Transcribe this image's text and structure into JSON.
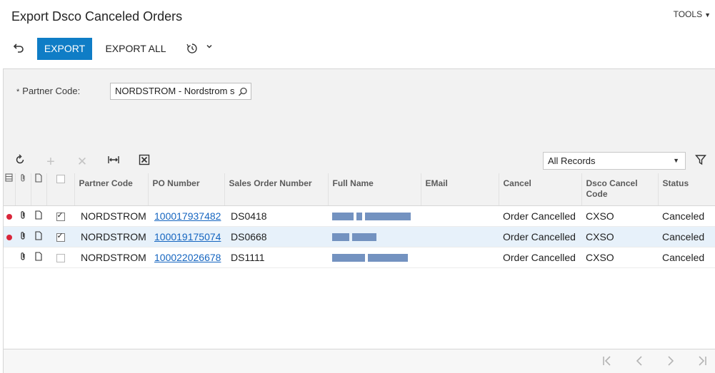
{
  "header": {
    "title": "Export Dsco Canceled Orders",
    "tools_label": "TOOLS"
  },
  "toolbar": {
    "export_label": "EXPORT",
    "export_all_label": "EXPORT ALL",
    "undo_icon": "undo-icon",
    "history_icon": "history-icon"
  },
  "form": {
    "partner_code_label": "Partner Code:",
    "required_mark": "*",
    "partner_code_value": "NORDSTROM - Nordstrom s"
  },
  "grid_toolbar": {
    "records_filter": "All Records"
  },
  "grid": {
    "columns": [
      "Partner Code",
      "PO Number",
      "Sales Order Number",
      "Full Name",
      "EMail",
      "Cancel",
      "Dsco Cancel Code",
      "Status"
    ],
    "rows": [
      {
        "error": true,
        "selected": true,
        "partner_code": "NORDSTROM",
        "po_number": "100017937482",
        "sales_order": "DS0418",
        "email": "",
        "cancel": "Order Cancelled",
        "cancel_code": "CXSO",
        "status": "Canceled"
      },
      {
        "error": true,
        "selected": true,
        "partner_code": "NORDSTROM",
        "po_number": "100019175074",
        "sales_order": "DS0668",
        "email": "",
        "cancel": "Order Cancelled",
        "cancel_code": "CXSO",
        "status": "Canceled"
      },
      {
        "error": false,
        "selected": false,
        "partner_code": "NORDSTROM",
        "po_number": "100022026678",
        "sales_order": "DS1111",
        "email": "",
        "cancel": "Order Cancelled",
        "cancel_code": "CXSO",
        "status": "Canceled"
      }
    ]
  },
  "colors": {
    "accent": "#0f7dc6",
    "error_dot": "#d9263a",
    "link": "#1565c0",
    "selected_row": "#e7f1fa"
  }
}
